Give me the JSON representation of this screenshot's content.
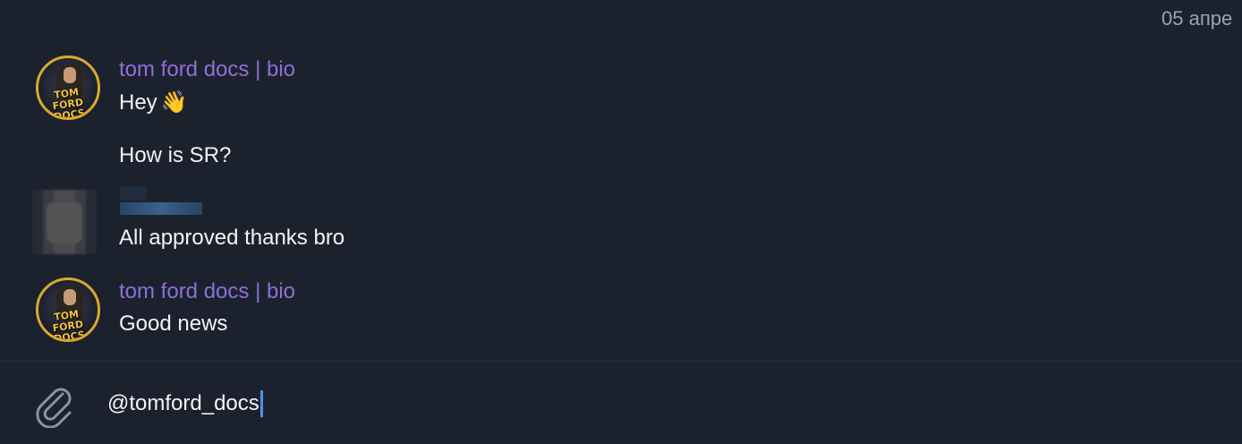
{
  "date": "05 апре",
  "messages": [
    {
      "sender": "tom ford docs | bio",
      "avatar": "tom-ford-docs-logo",
      "lines": [
        "Hey",
        "How is SR?"
      ],
      "emoji": "👋"
    },
    {
      "sender": "",
      "avatar": "blurred-avatar",
      "lines": [
        "All approved thanks bro"
      ]
    },
    {
      "sender": "tom ford docs | bio",
      "avatar": "tom-ford-docs-logo",
      "lines": [
        "Good news"
      ]
    }
  ],
  "avatar_logo_text": "TOM FORD DOCS",
  "composer": {
    "value": "@tomford_docs",
    "attach_icon": "paperclip-icon"
  },
  "colors": {
    "background": "#1c222d",
    "sender": "#8e6fd8",
    "text": "#f2f4f7",
    "date": "#9aa3ad",
    "caret": "#4f8fea"
  }
}
